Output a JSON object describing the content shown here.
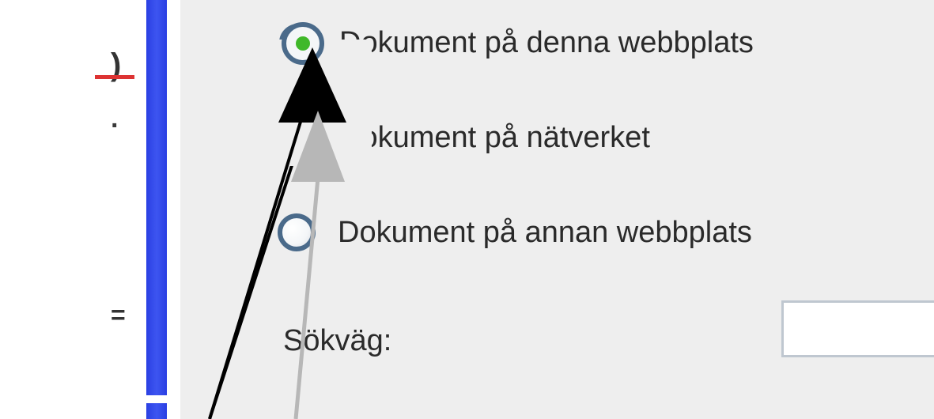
{
  "radios": {
    "r1": {
      "label": "Dokument på denna webbplats",
      "checked": true
    },
    "r2": {
      "label": "Dokument på nätverket",
      "checked": false
    },
    "r3": {
      "label": "Dokument på annan webbplats",
      "checked": false
    }
  },
  "path": {
    "label": "Sökväg:",
    "value": ""
  },
  "left_glyphs": {
    "g1": ")",
    "g2": "·",
    "g3": "="
  }
}
